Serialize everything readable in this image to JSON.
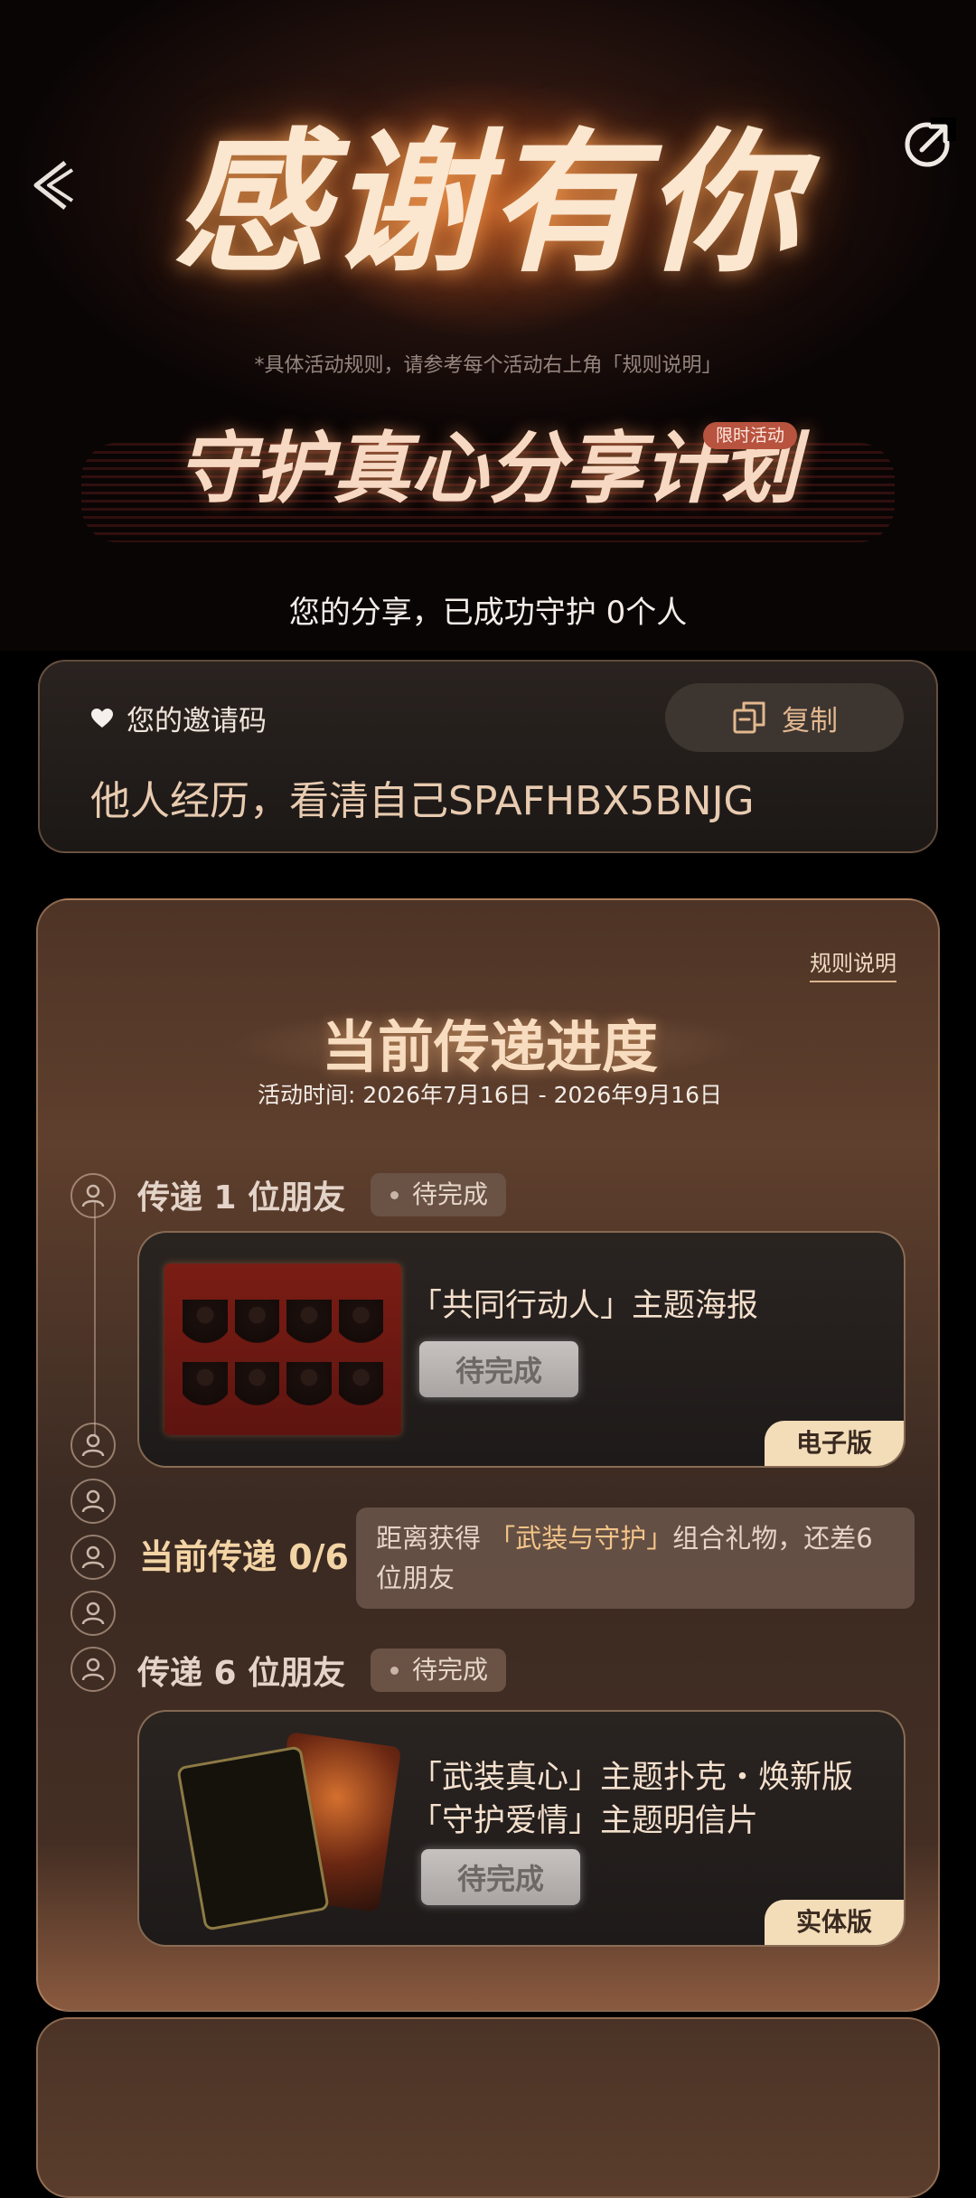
{
  "hero": {
    "title": "感谢有你",
    "note": "*具体活动规则，请参考每个活动右上角「规则说明」",
    "limited_badge": "限时活动",
    "campaign_title": "守护真心分享计划",
    "share_status": "您的分享，已成功守护 0个人"
  },
  "invite": {
    "label": "您的邀请码",
    "copy_label": "复制",
    "code": "他人经历，看清自己SPAFHBX5BNJG"
  },
  "progress": {
    "rules_link": "规则说明",
    "title": "当前传递进度",
    "date": "活动时间: 2026年7月16日 - 2026年9月16日",
    "steps": [
      {
        "title": "传递 1 位朋友",
        "status": "待完成",
        "reward": {
          "lines": [
            "「共同行动人」主题海报"
          ],
          "button": "待完成",
          "edition": "电子版"
        }
      },
      {
        "title": "传递 6 位朋友",
        "status": "待完成",
        "reward": {
          "lines": [
            "「武装真心」主题扑克・焕新版",
            "「守护爱情」主题明信片"
          ],
          "button": "待完成",
          "edition": "实体版"
        }
      }
    ],
    "current": {
      "label": "当前传递 0/6",
      "tip_prefix": "距离获得 ",
      "tip_highlight": "「武装与守护」",
      "tip_suffix": "组合礼物，还差6位朋友"
    }
  },
  "colors": {
    "accent_gold": "#f3d4a5",
    "badge_red": "#b8533f",
    "edition_tag": "#f3dcb8"
  },
  "icons": {
    "back": "back-arrow-icon",
    "share": "share-icon",
    "heart": "heart-icon",
    "copy": "copy-icon",
    "step_user": "user-circle-icon"
  }
}
